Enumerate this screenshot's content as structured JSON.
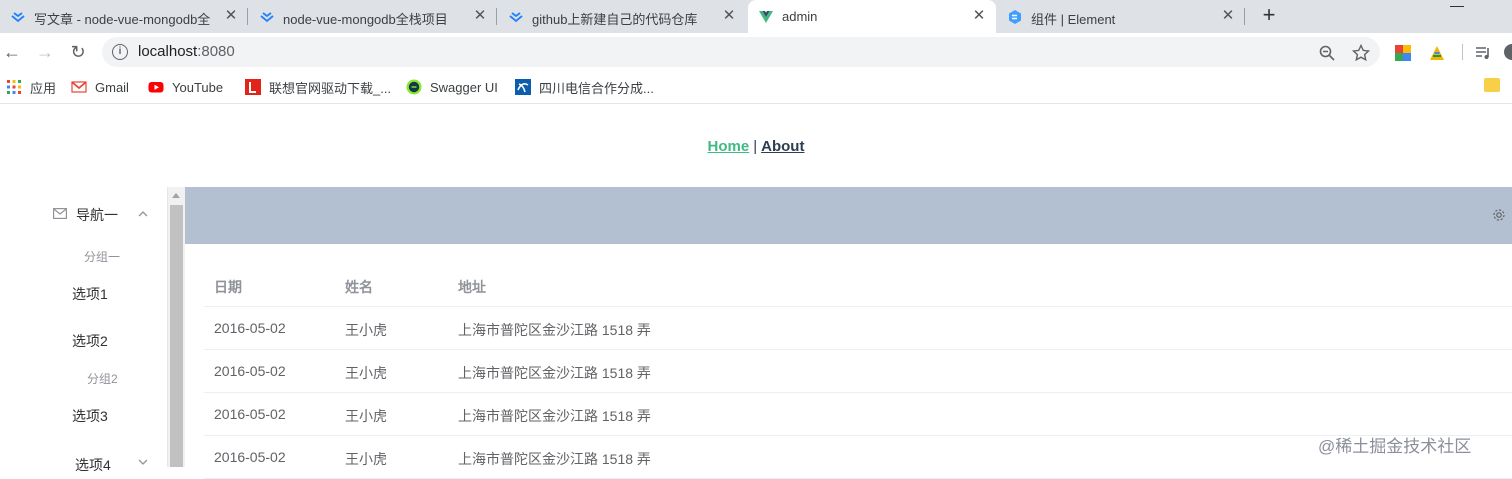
{
  "browser": {
    "tabs": [
      {
        "title": "写文章 - node-vue-mongodb全",
        "favicon": "juejin-icon",
        "active": false
      },
      {
        "title": "node-vue-mongodb全栈项目",
        "favicon": "juejin-icon",
        "active": false
      },
      {
        "title": "github上新建自己的代码仓库",
        "favicon": "juejin-icon",
        "active": false
      },
      {
        "title": "admin",
        "favicon": "vue-icon",
        "active": true
      },
      {
        "title": "组件 | Element",
        "favicon": "element-icon",
        "active": false
      }
    ],
    "close_glyph": "✕",
    "new_tab_glyph": "+",
    "address": {
      "host": "localhost",
      "port": ":8080"
    },
    "bookmarks": [
      {
        "label": "应用",
        "icon": "apps-grid-icon"
      },
      {
        "label": "Gmail",
        "icon": "gmail-icon"
      },
      {
        "label": "YouTube",
        "icon": "youtube-icon"
      },
      {
        "label": "联想官网驱动下载_...",
        "icon": "lenovo-icon"
      },
      {
        "label": "Swagger UI",
        "icon": "swagger-icon"
      },
      {
        "label": "四川电信合作分成...",
        "icon": "telecom-icon"
      }
    ]
  },
  "app": {
    "nav": {
      "home": "Home",
      "separator": "|",
      "about": "About"
    },
    "sidebar": {
      "menu_title": "导航一",
      "group1": "分组一",
      "item1": "选项1",
      "item2": "选项2",
      "group2": "分组2",
      "item3": "选项3",
      "submenu": "选项4"
    },
    "table": {
      "headers": [
        "日期",
        "姓名",
        "地址"
      ],
      "rows": [
        [
          "2016-05-02",
          "王小虎",
          "上海市普陀区金沙江路 1518 弄"
        ],
        [
          "2016-05-02",
          "王小虎",
          "上海市普陀区金沙江路 1518 弄"
        ],
        [
          "2016-05-02",
          "王小虎",
          "上海市普陀区金沙江路 1518 弄"
        ],
        [
          "2016-05-02",
          "王小虎",
          "上海市普陀区金沙江路 1518 弄"
        ]
      ]
    },
    "watermark": "@稀土掘金技术社区"
  },
  "colors": {
    "header_bg": "#b3c0d1",
    "home_link": "#42b983",
    "text_dark": "#2c3e50"
  }
}
